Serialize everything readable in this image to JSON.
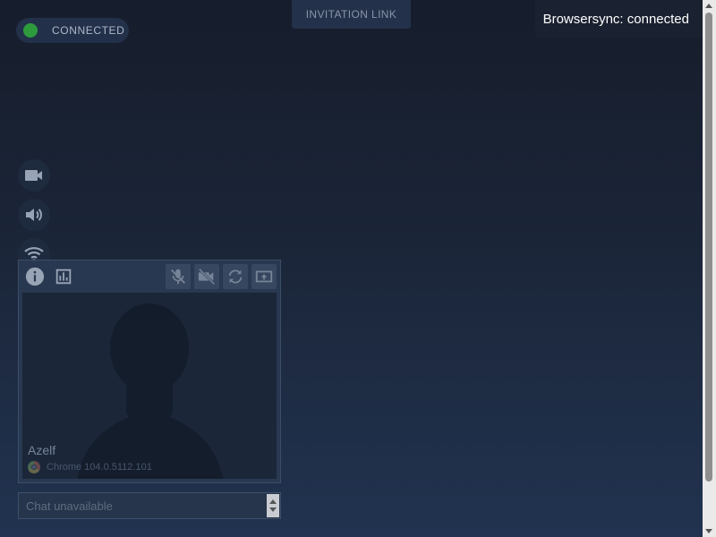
{
  "connection": {
    "label": "CONNECTED",
    "status_color": "#2d9a3c"
  },
  "toolbar": {
    "invitation_label": "INVITATION LINK"
  },
  "notification": {
    "text": "Browsersync: connected"
  },
  "side_controls": [
    {
      "icon": "video-camera-icon"
    },
    {
      "icon": "speaker-icon"
    },
    {
      "icon": "wifi-icon"
    }
  ],
  "peer_panel": {
    "toolbar_left": [
      "info-icon",
      "stats-icon"
    ],
    "toolbar_right": [
      "mic-off-icon",
      "video-off-icon",
      "refresh-icon",
      "screen-share-icon"
    ],
    "peer_name": "Azelf",
    "browser": "Chrome 104.0.5112.101"
  },
  "chat": {
    "placeholder": "Chat unavailable"
  },
  "colors": {
    "accent_green": "#2d9a3c",
    "background": "#1b2538"
  }
}
